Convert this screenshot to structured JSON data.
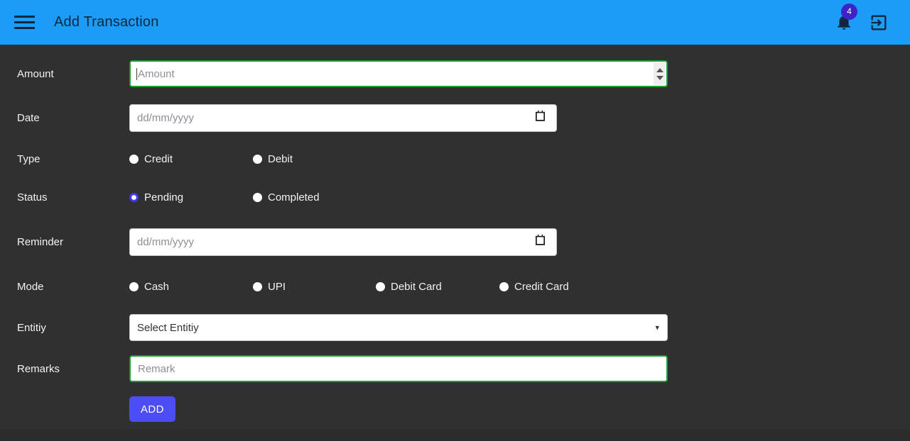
{
  "header": {
    "title": "Add Transaction",
    "menu_icon": "hamburger-menu-icon",
    "notification_icon": "bell-icon",
    "notification_count": "4",
    "logout_icon": "logout-icon",
    "background_color": "#1a9cf8",
    "badge_color": "#3c22c8"
  },
  "theme": {
    "page_background": "#303030",
    "text_color": "#f2f2f2",
    "focus_border": "#19a336",
    "accent": "#4d4df5"
  },
  "form": {
    "amount": {
      "label": "Amount",
      "placeholder": "Amount",
      "value": "",
      "focused": true
    },
    "date": {
      "label": "Date",
      "placeholder": "dd/mm/yyyy",
      "value": "",
      "picker_icon": "calendar-icon"
    },
    "type": {
      "label": "Type",
      "options": [
        {
          "label": "Credit",
          "selected": false
        },
        {
          "label": "Debit",
          "selected": false
        }
      ]
    },
    "status": {
      "label": "Status",
      "options": [
        {
          "label": "Pending",
          "selected": true
        },
        {
          "label": "Completed",
          "selected": false
        }
      ]
    },
    "reminder": {
      "label": "Reminder",
      "placeholder": "dd/mm/yyyy",
      "value": "",
      "picker_icon": "calendar-icon"
    },
    "mode": {
      "label": "Mode",
      "options": [
        {
          "label": "Cash",
          "selected": false
        },
        {
          "label": "UPI",
          "selected": false
        },
        {
          "label": "Debit Card",
          "selected": false
        },
        {
          "label": "Credit Card",
          "selected": false
        }
      ]
    },
    "entity": {
      "label": "Entitiy",
      "selected_option": "Select Entitiy",
      "dropdown_icon": "chevron-down-icon"
    },
    "remarks": {
      "label": "Remarks",
      "placeholder": "Remark",
      "value": "",
      "focused": true
    },
    "submit": {
      "label": "ADD"
    }
  }
}
